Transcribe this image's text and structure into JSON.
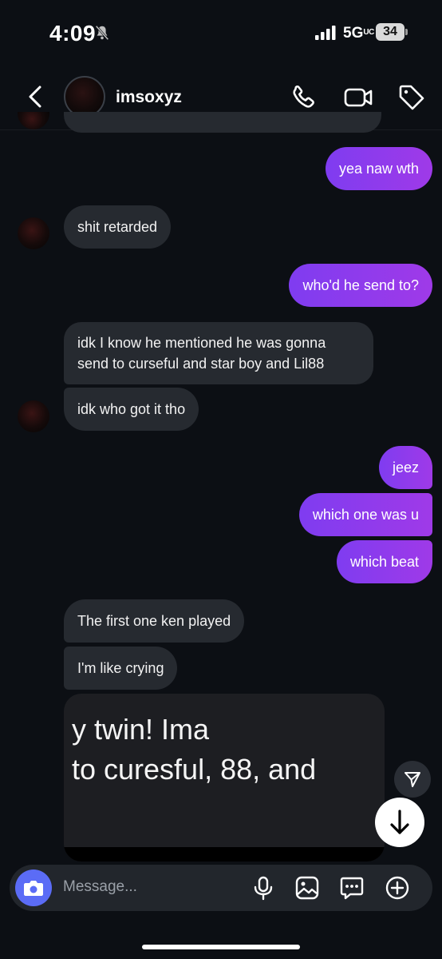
{
  "status_bar": {
    "time": "4:09",
    "network": "5G",
    "network_sub": "UC",
    "battery": "34"
  },
  "header": {
    "username": "imsoxyz"
  },
  "messages": [
    {
      "side": "out",
      "text": "yea naw wth"
    },
    {
      "side": "in",
      "text": "shit retarded"
    },
    {
      "side": "out",
      "text": "who'd he send to?"
    },
    {
      "side": "in",
      "text": "idk I know he mentioned he was gonna send to curseful and star boy and Lil88"
    },
    {
      "side": "in",
      "text": "idk who got it tho"
    },
    {
      "side": "out",
      "text": "jeez"
    },
    {
      "side": "out",
      "text": "which one was u"
    },
    {
      "side": "out",
      "text": "which beat"
    },
    {
      "side": "in",
      "text": "The first one ken played"
    },
    {
      "side": "in",
      "text": "I'm like crying"
    }
  ],
  "shared_post": {
    "line1": "y twin! Ima",
    "line2": " to curesful, 88, and"
  },
  "composer": {
    "placeholder": "Message..."
  },
  "colors": {
    "outgoing": "#8b3bf0",
    "incoming": "#262a30",
    "camera": "#5b6cf6",
    "background": "#0c0f14"
  },
  "icons": [
    "back-chevron-icon",
    "phone-icon",
    "video-icon",
    "tag-icon",
    "send-icon",
    "arrow-down-icon",
    "camera-icon",
    "mic-icon",
    "image-icon",
    "sticker-icon",
    "plus-icon",
    "bell-off-icon",
    "signal-icon"
  ]
}
